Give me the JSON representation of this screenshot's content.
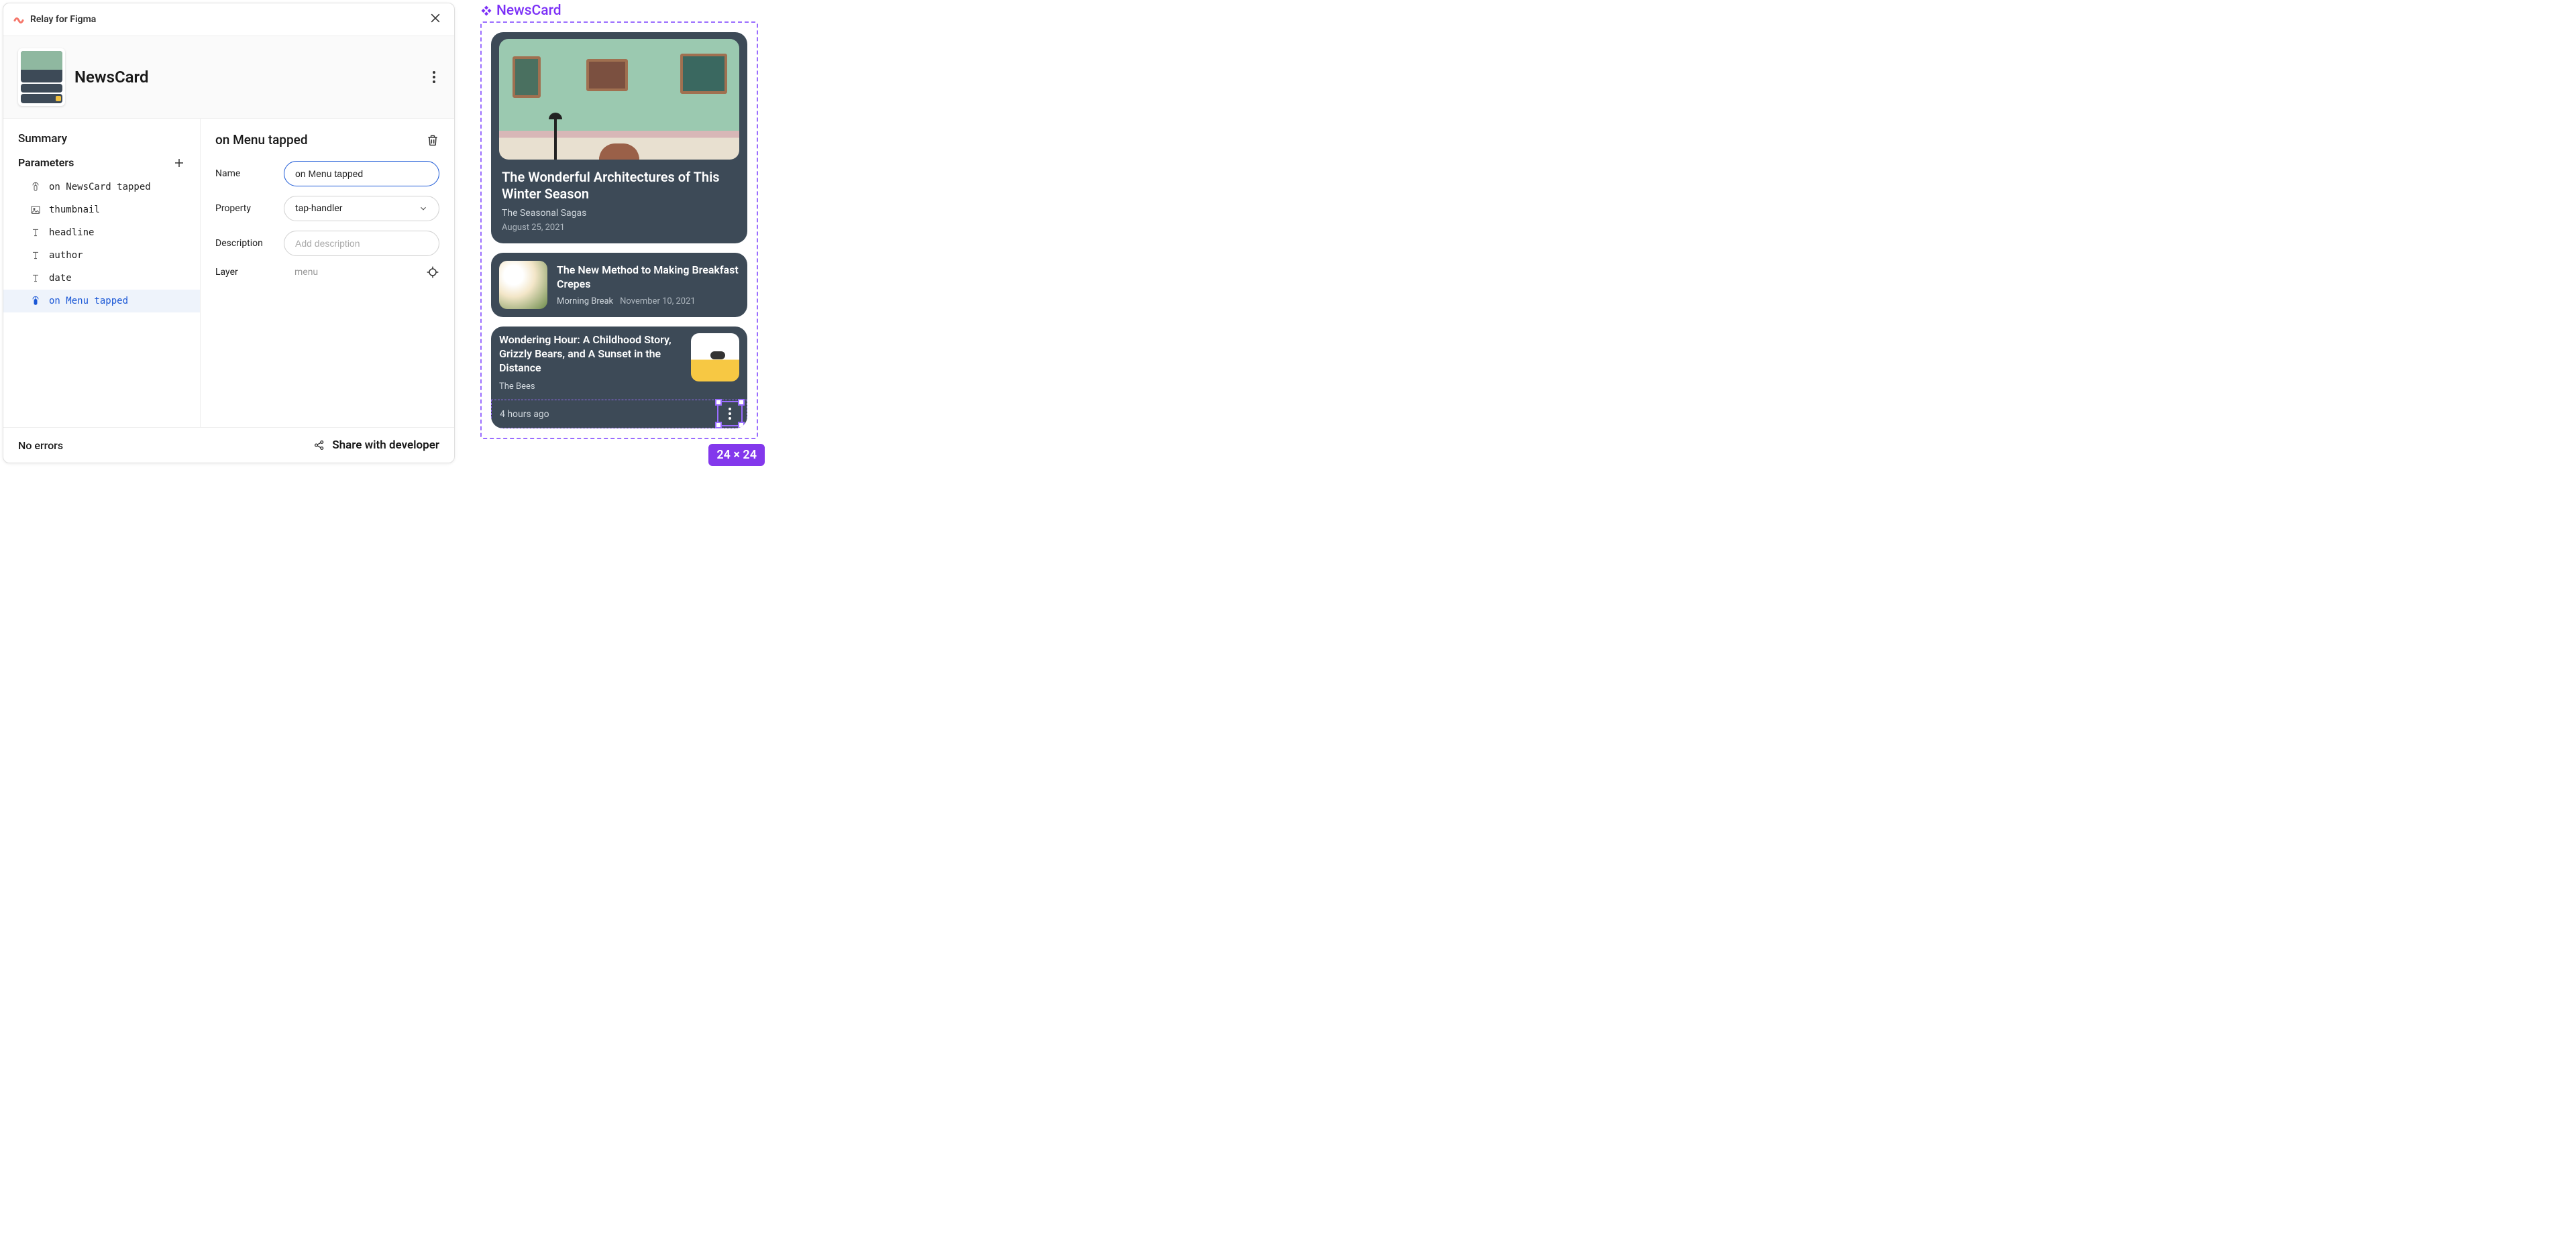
{
  "plugin": {
    "name": "Relay for Figma"
  },
  "component": {
    "name": "NewsCard"
  },
  "sidebar": {
    "summary": "Summary",
    "parameters_label": "Parameters",
    "params": [
      {
        "icon": "tap",
        "label": "on NewsCard tapped"
      },
      {
        "icon": "image",
        "label": "thumbnail"
      },
      {
        "icon": "text",
        "label": "headline"
      },
      {
        "icon": "text",
        "label": "author"
      },
      {
        "icon": "text",
        "label": "date"
      },
      {
        "icon": "tap",
        "label": "on Menu tapped",
        "selected": true
      }
    ]
  },
  "detail": {
    "title": "on Menu tapped",
    "fields": {
      "name_label": "Name",
      "name_value": "on Menu tapped",
      "property_label": "Property",
      "property_value": "tap-handler",
      "description_label": "Description",
      "description_placeholder": "Add description",
      "layer_label": "Layer",
      "layer_value": "menu"
    }
  },
  "footer": {
    "status": "No errors",
    "share": "Share with developer"
  },
  "preview": {
    "label": "NewsCard",
    "size_badge": "24 × 24",
    "hero": {
      "title": "The Wonderful Architectures of This Winter Season",
      "author": "The Seasonal Sagas",
      "date": "August 25, 2021"
    },
    "item2": {
      "title": "The New Method to Making Breakfast Crepes",
      "author": "Morning Break",
      "date": "November 10, 2021"
    },
    "item3": {
      "title": "Wondering Hour: A Childhood Story, Grizzly Bears, and A Sunset in the Distance",
      "author": "The Bees",
      "date": "4 hours ago"
    }
  }
}
